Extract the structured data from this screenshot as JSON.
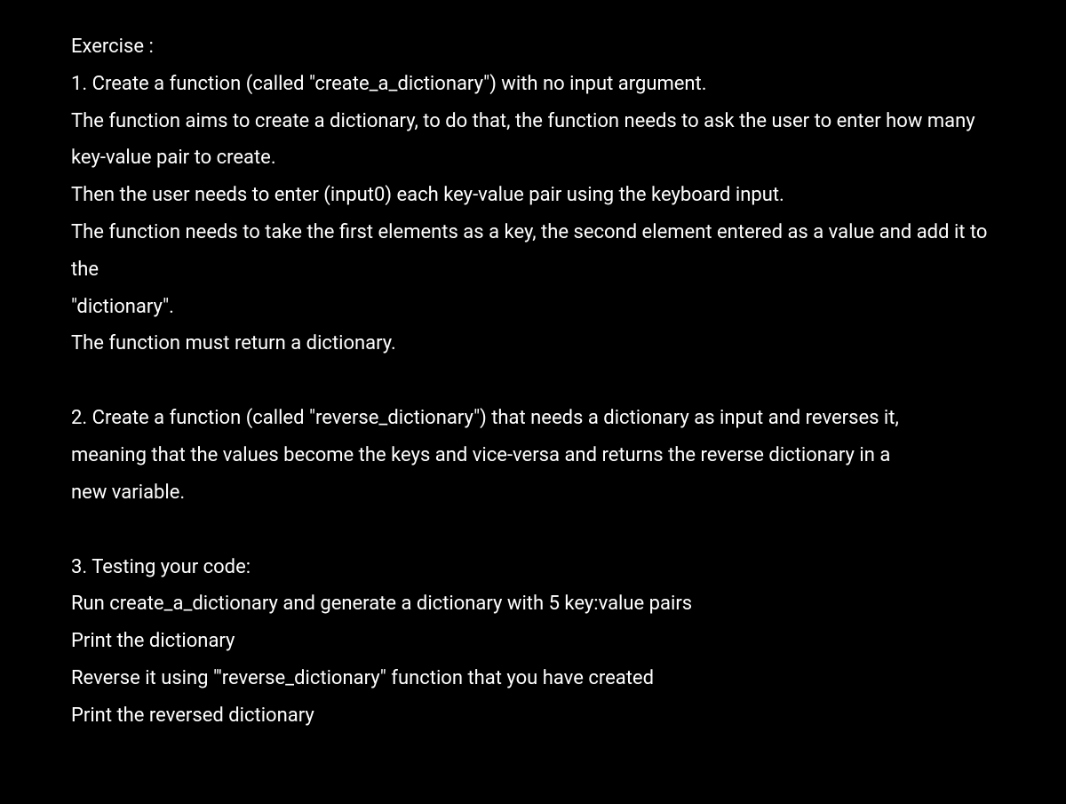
{
  "exercise": {
    "title": "Exercise :",
    "section1": {
      "line1": "1.  Create a function (called \"create_a_dictionary\") with no input argument.",
      "line2": "The function aims to create a dictionary, to do that, the function needs to ask the user to enter how many key-value pair to create.",
      "line3": "Then the user needs to enter (input0) each key-value pair using the keyboard input.",
      "line4": "The function needs to take the first elements as a key, the second element entered as a value and add it to the",
      "line5": "\"dictionary\".",
      "line6": "The function must return a dictionary."
    },
    "section2": {
      "line1": "2.  Create a function (called \"reverse_dictionary\") that needs a dictionary as input and reverses it,",
      "line2": "meaning that the values become the keys and vice-versa and returns the reverse dictionary in a",
      "line3": "new variable."
    },
    "section3": {
      "line1": "3. Testing your code:",
      "line2": "Run create_a_dictionary and generate a dictionary with 5 key:value pairs",
      "line3": "Print the dictionary",
      "line4": "Reverse it using \"'reverse_dictionary\" function that you have created",
      "line5": "Print the reversed dictionary"
    }
  }
}
